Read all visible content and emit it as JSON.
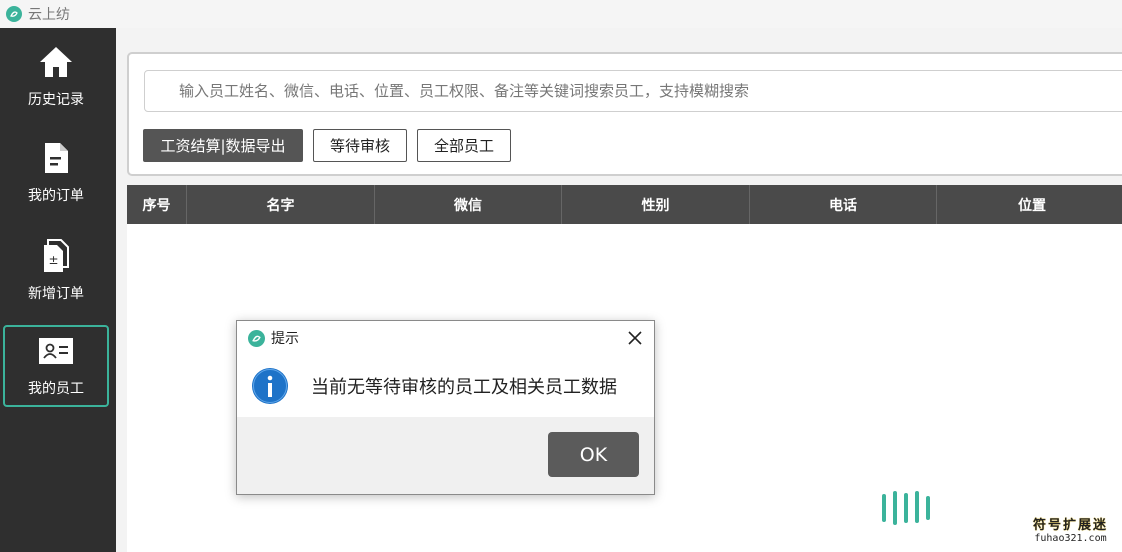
{
  "app": {
    "title": "云上纺"
  },
  "sidebar": {
    "items": [
      {
        "label": "历史记录",
        "icon": "home-icon"
      },
      {
        "label": "我的订单",
        "icon": "document-icon"
      },
      {
        "label": "新增订单",
        "icon": "add-document-icon"
      },
      {
        "label": "我的员工",
        "icon": "employee-card-icon",
        "active": true
      }
    ]
  },
  "search": {
    "placeholder": "输入员工姓名、微信、电话、位置、员工权限、备注等关键词搜索员工，支持模糊搜索",
    "value": ""
  },
  "toolbar": {
    "export_label": "工资结算|数据导出",
    "pending_label": "等待审核",
    "all_label": "全部员工"
  },
  "table": {
    "columns": [
      "序号",
      "名字",
      "微信",
      "性别",
      "电话",
      "位置"
    ],
    "rows": []
  },
  "dialog": {
    "title": "提示",
    "message": "当前无等待审核的员工及相关员工数据",
    "ok_label": "OK"
  },
  "watermark": {
    "line1": "符号扩展迷",
    "line2": "fuhao321.com"
  },
  "colors": {
    "accent": "#3bb39b",
    "sidebar_bg": "#2f2f2f",
    "header_bg": "#4a4a4a",
    "button_dark": "#555555",
    "info_blue": "#1e73c8"
  }
}
